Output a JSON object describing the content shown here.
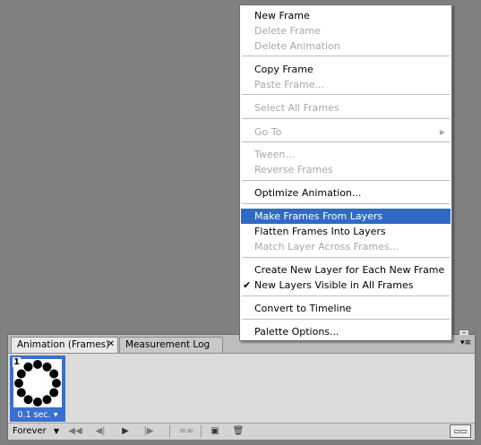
{
  "menu": {
    "items": {
      "new_frame": "New Frame",
      "delete_frame": "Delete Frame",
      "delete_animation": "Delete Animation",
      "copy_frame": "Copy Frame",
      "paste_frame": "Paste Frame...",
      "select_all_frames": "Select All Frames",
      "go_to": "Go To",
      "tween": "Tween...",
      "reverse_frames": "Reverse Frames",
      "optimize_animation": "Optimize Animation...",
      "make_frames_from_layers": "Make Frames From Layers",
      "flatten_frames_into_layers": "Flatten Frames Into Layers",
      "match_layer_across_frames": "Match Layer Across Frames...",
      "create_new_layer_each_frame": "Create New Layer for Each New Frame",
      "new_layers_visible": "New Layers Visible in All Frames",
      "convert_to_timeline": "Convert to Timeline",
      "palette_options": "Palette Options..."
    },
    "checkmark": "✔",
    "submenu_arrow": "▶",
    "highlight_color": "#316ac5"
  },
  "panel": {
    "tabs": [
      {
        "label": "Animation (Frames)",
        "close": "✕"
      },
      {
        "label": "Measurement Log"
      }
    ],
    "menu_icon": "▾≡",
    "frames": [
      {
        "number": "1",
        "delay": "0.1 sec.",
        "delay_arrow": "▾"
      }
    ],
    "loop": {
      "value": "Forever",
      "arrow": "▼"
    },
    "controls": {
      "first_frame": "◀◀",
      "prev_frame": "◀|",
      "play": "▶",
      "next_frame": "|▶",
      "tween": "∞∞",
      "new_frame": "▣",
      "delete_frame": "🗑"
    }
  }
}
